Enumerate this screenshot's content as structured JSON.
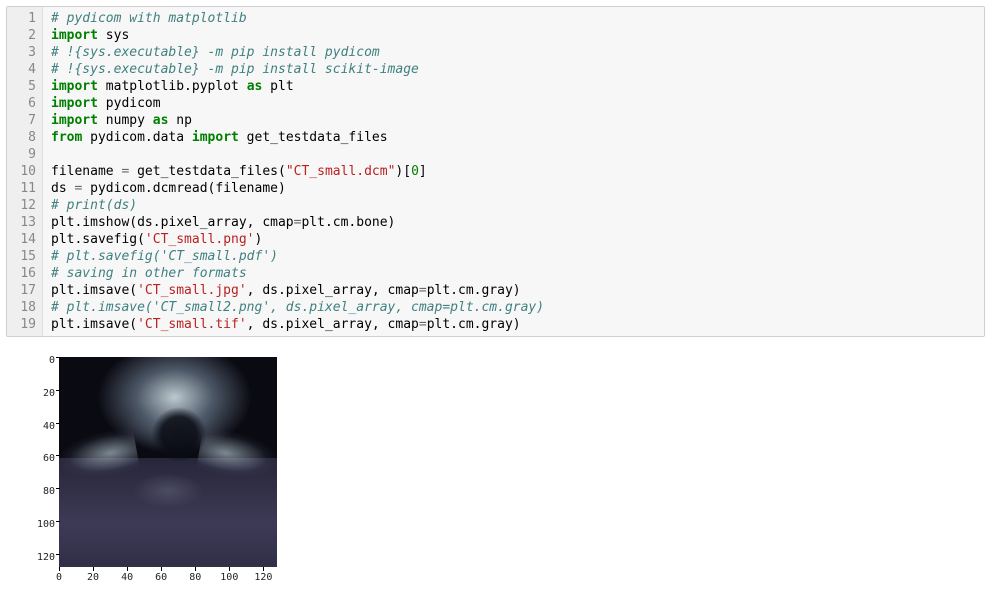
{
  "code": {
    "line_numbers": [
      "1",
      "2",
      "3",
      "4",
      "5",
      "6",
      "7",
      "8",
      "9",
      "10",
      "11",
      "12",
      "13",
      "14",
      "15",
      "16",
      "17",
      "18",
      "19"
    ],
    "lines": [
      [
        {
          "cls": "c",
          "t": "# pydicom with matplotlib"
        }
      ],
      [
        {
          "cls": "kn",
          "t": "import"
        },
        {
          "cls": "n",
          "t": " sys"
        }
      ],
      [
        {
          "cls": "c",
          "t": "# !{sys.executable} -m pip install pydicom"
        }
      ],
      [
        {
          "cls": "c",
          "t": "# !{sys.executable} -m pip install scikit-image"
        }
      ],
      [
        {
          "cls": "kn",
          "t": "import"
        },
        {
          "cls": "n",
          "t": " matplotlib.pyplot "
        },
        {
          "cls": "kn",
          "t": "as"
        },
        {
          "cls": "n",
          "t": " plt"
        }
      ],
      [
        {
          "cls": "kn",
          "t": "import"
        },
        {
          "cls": "n",
          "t": " pydicom"
        }
      ],
      [
        {
          "cls": "kn",
          "t": "import"
        },
        {
          "cls": "n",
          "t": " numpy "
        },
        {
          "cls": "kn",
          "t": "as"
        },
        {
          "cls": "n",
          "t": " np"
        }
      ],
      [
        {
          "cls": "kn",
          "t": "from"
        },
        {
          "cls": "n",
          "t": " pydicom.data "
        },
        {
          "cls": "kn",
          "t": "import"
        },
        {
          "cls": "n",
          "t": " get_testdata_files"
        }
      ],
      [
        {
          "cls": "n",
          "t": ""
        }
      ],
      [
        {
          "cls": "n",
          "t": "filename "
        },
        {
          "cls": "o",
          "t": "="
        },
        {
          "cls": "n",
          "t": " get_testdata_files("
        },
        {
          "cls": "s",
          "t": "\"CT_small.dcm\""
        },
        {
          "cls": "n",
          "t": ")["
        },
        {
          "cls": "num",
          "t": "0"
        },
        {
          "cls": "n",
          "t": "]"
        }
      ],
      [
        {
          "cls": "n",
          "t": "ds "
        },
        {
          "cls": "o",
          "t": "="
        },
        {
          "cls": "n",
          "t": " pydicom.dcmread(filename)"
        }
      ],
      [
        {
          "cls": "c",
          "t": "# print(ds)"
        }
      ],
      [
        {
          "cls": "n",
          "t": "plt.imshow(ds.pixel_array, cmap"
        },
        {
          "cls": "o",
          "t": "="
        },
        {
          "cls": "n",
          "t": "plt.cm.bone)"
        }
      ],
      [
        {
          "cls": "n",
          "t": "plt.savefig("
        },
        {
          "cls": "s",
          "t": "'CT_small.png'"
        },
        {
          "cls": "n",
          "t": ")"
        }
      ],
      [
        {
          "cls": "c",
          "t": "# plt.savefig('CT_small.pdf')"
        }
      ],
      [
        {
          "cls": "c",
          "t": "# saving in other formats"
        }
      ],
      [
        {
          "cls": "n",
          "t": "plt.imsave("
        },
        {
          "cls": "s",
          "t": "'CT_small.jpg'"
        },
        {
          "cls": "n",
          "t": ", ds.pixel_array, cmap"
        },
        {
          "cls": "o",
          "t": "="
        },
        {
          "cls": "n",
          "t": "plt.cm.gray)"
        }
      ],
      [
        {
          "cls": "c",
          "t": "# plt.imsave('CT_small2.png', ds.pixel_array, cmap=plt.cm.gray)"
        }
      ],
      [
        {
          "cls": "n",
          "t": "plt.imsave("
        },
        {
          "cls": "s",
          "t": "'CT_small.tif'"
        },
        {
          "cls": "n",
          "t": ", ds.pixel_array, cmap"
        },
        {
          "cls": "o",
          "t": "="
        },
        {
          "cls": "n",
          "t": "plt.cm.gray)"
        }
      ]
    ]
  },
  "chart_data": {
    "type": "heatmap",
    "title": "",
    "xlabel": "",
    "ylabel": "",
    "xlim": [
      0,
      128
    ],
    "ylim": [
      128,
      0
    ],
    "x_ticks": [
      0,
      20,
      40,
      60,
      80,
      100,
      120
    ],
    "y_ticks": [
      0,
      20,
      40,
      60,
      80,
      100,
      120
    ],
    "colormap": "bone",
    "description": "CT axial slice (128×128) rendered with matplotlib bone colormap; bright vertebral body and posterior arch centered, dark air/foam at top corners, mid-gray soft tissue in lower half."
  }
}
